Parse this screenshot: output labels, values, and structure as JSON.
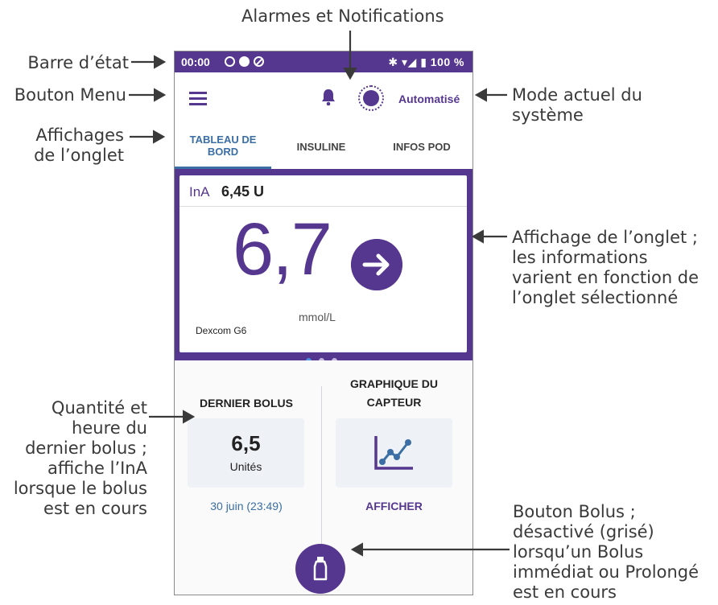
{
  "annotations": {
    "status_bar": "Barre d’état",
    "alarms": "Alarmes et Notifications",
    "menu_button": "Bouton Menu",
    "tab_displays": [
      "Affichages",
      "de l’onglet"
    ],
    "current_mode": [
      "Mode actuel du",
      "système"
    ],
    "tab_panel": [
      "Affichage de l’onglet ;",
      "les informations",
      "varient en fonction de",
      "l’onglet sélectionné"
    ],
    "last_bolus": [
      "Quantité et",
      "heure du",
      "dernier bolus ;",
      "affiche l’InA",
      "lorsque le bolus",
      "est en cours"
    ],
    "bolus_button": [
      "Bouton Bolus ;",
      "désactivé (grisé)",
      "lorsqu’un Bolus",
      "immédiat ou Prolongé",
      "est en cours"
    ]
  },
  "status_bar": {
    "time": "00:00",
    "right": "✱ ▾◢ ▮ 100 %"
  },
  "header": {
    "mode_label": "Automatisé"
  },
  "tabs": [
    {
      "label": "TABLEAU DE BORD",
      "active": true
    },
    {
      "label": "INSULINE",
      "active": false
    },
    {
      "label": "INFOS POD",
      "active": false
    }
  ],
  "dashboard": {
    "iob_label": "InA",
    "iob_value": "6,45 U",
    "glucose_value": "6,7",
    "glucose_unit": "mmol/L",
    "trend": "arrow-right-icon",
    "sensor": "Dexcom G6",
    "pager_dots": 3,
    "active_dot": 0
  },
  "last_bolus": {
    "title": "DERNIER BOLUS",
    "amount": "6,5",
    "unit": "Unités",
    "time": "30 juin (23:49)"
  },
  "sensor_graph": {
    "title_line1": "GRAPHIQUE DU",
    "title_line2": "CAPTEUR",
    "icon": "line-chart-icon",
    "link": "AFFICHER"
  },
  "colors": {
    "primary": "#56378f",
    "accent": "#3a6ea5"
  }
}
